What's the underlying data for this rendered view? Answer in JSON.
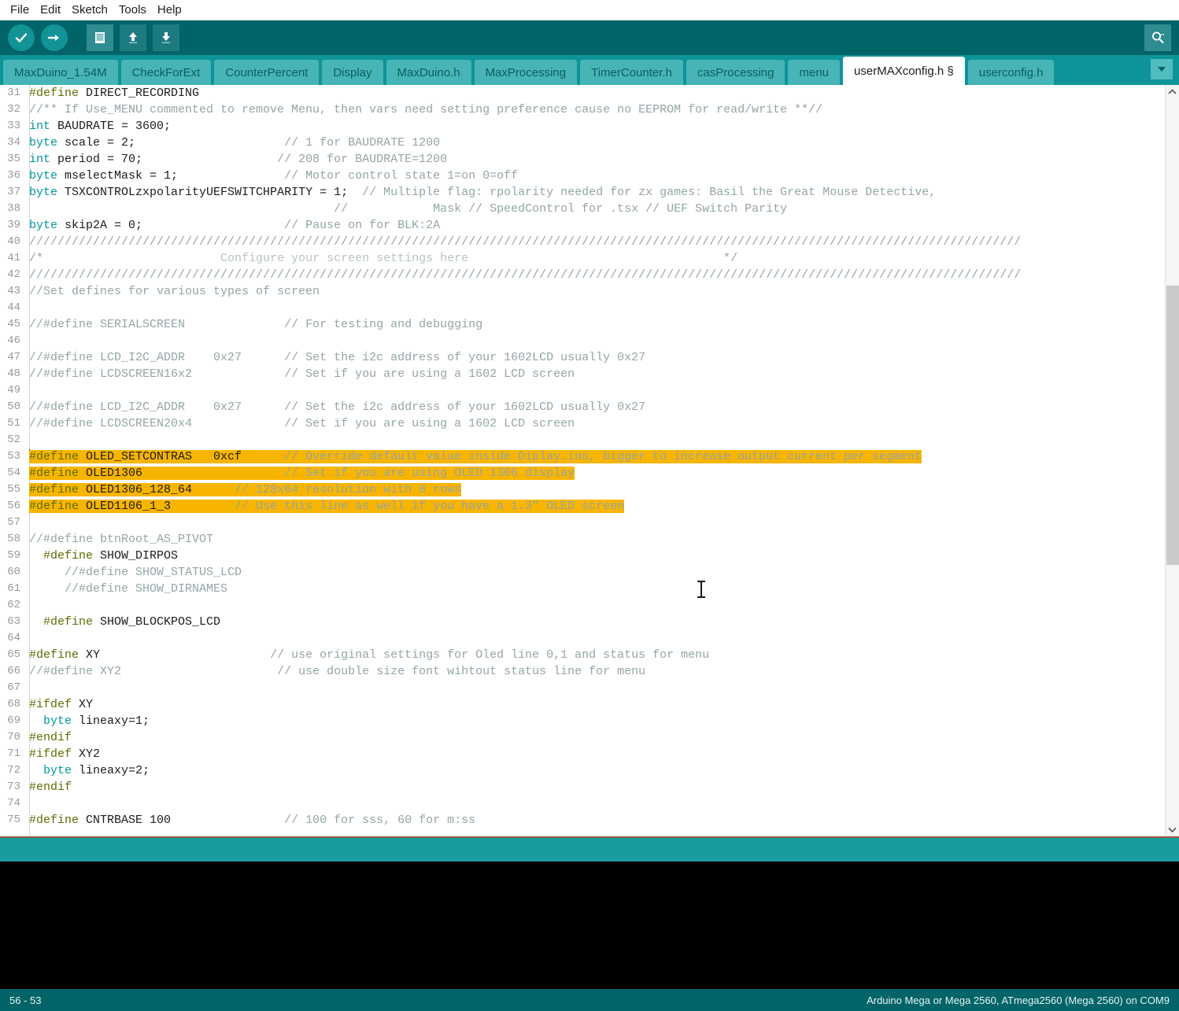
{
  "menubar": {
    "items": [
      {
        "label": "File"
      },
      {
        "label": "Edit"
      },
      {
        "label": "Sketch"
      },
      {
        "label": "Tools"
      },
      {
        "label": "Help"
      }
    ]
  },
  "toolbar": {
    "verify_label": "Verify",
    "upload_label": "Upload",
    "new_label": "New",
    "open_label": "Open",
    "save_label": "Save",
    "serial_monitor_label": "Serial Monitor",
    "colors": {
      "bar": "#006468",
      "round_button": "#129396",
      "square_button": "#2f8c90"
    }
  },
  "tabs": {
    "items": [
      {
        "label": "MaxDuino_1.54M",
        "active": false
      },
      {
        "label": "CheckForExt",
        "active": false
      },
      {
        "label": "CounterPercent",
        "active": false
      },
      {
        "label": "Display",
        "active": false
      },
      {
        "label": "MaxDuino.h",
        "active": false
      },
      {
        "label": "MaxProcessing",
        "active": false
      },
      {
        "label": "TimerCounter.h",
        "active": false
      },
      {
        "label": "casProcessing",
        "active": false
      },
      {
        "label": "menu",
        "active": false
      },
      {
        "label": "userMAXconfig.h §",
        "active": true
      },
      {
        "label": "userconfig.h",
        "active": false
      }
    ],
    "dropdown_label": "▼"
  },
  "editor": {
    "first_line_number": 31,
    "selection_color": "#f8b500",
    "lines": [
      {
        "n": 31,
        "parts": [
          {
            "t": "#define",
            "c": "pre"
          },
          {
            "t": " DIRECT_RECORDING",
            "c": "plain"
          }
        ]
      },
      {
        "n": 32,
        "parts": [
          {
            "t": "//** If Use_MENU commented to remove Menu, then vars need setting preference cause no EEPROM for read/write **//",
            "c": "com"
          }
        ]
      },
      {
        "n": 33,
        "parts": [
          {
            "t": "int",
            "c": "kw"
          },
          {
            "t": " BAUDRATE = 3600;",
            "c": "plain"
          }
        ]
      },
      {
        "n": 34,
        "parts": [
          {
            "t": "byte",
            "c": "kw"
          },
          {
            "t": " scale = 2;                     ",
            "c": "plain"
          },
          {
            "t": "// 1 for BAUDRATE 1200",
            "c": "com"
          }
        ]
      },
      {
        "n": 35,
        "parts": [
          {
            "t": "int",
            "c": "kw"
          },
          {
            "t": " period = 70;                   ",
            "c": "plain"
          },
          {
            "t": "// 208 for BAUDRATE=1200",
            "c": "com"
          }
        ]
      },
      {
        "n": 36,
        "parts": [
          {
            "t": "byte",
            "c": "kw"
          },
          {
            "t": " mselectMask = 1;               ",
            "c": "plain"
          },
          {
            "t": "// Motor control state 1=on 0=off",
            "c": "com"
          }
        ]
      },
      {
        "n": 37,
        "parts": [
          {
            "t": "byte",
            "c": "kw"
          },
          {
            "t": " TSXCONTROLzxpolarityUEFSWITCHPARITY = 1;  ",
            "c": "plain"
          },
          {
            "t": "// Multiple flag: rpolarity needed for zx games: Basil the Great Mouse Detective,",
            "c": "com"
          }
        ]
      },
      {
        "n": 38,
        "parts": [
          {
            "t": "                                           ",
            "c": "plain"
          },
          {
            "t": "//            Mask // SpeedControl for .tsx // UEF Switch Parity",
            "c": "com"
          }
        ]
      },
      {
        "n": 39,
        "parts": [
          {
            "t": "byte",
            "c": "kw"
          },
          {
            "t": " skip2A = 0;                    ",
            "c": "plain"
          },
          {
            "t": "// Pause on for BLK:2A",
            "c": "com"
          }
        ]
      },
      {
        "n": 40,
        "parts": [
          {
            "t": "////////////////////////////////////////////////////////////////////////////////////////////////////////////////////////////////////////////",
            "c": "com"
          }
        ]
      },
      {
        "n": 41,
        "parts": [
          {
            "t": "/*",
            "c": "com"
          },
          {
            "t": "                         Configure your screen settings here                                    ",
            "c": "light"
          },
          {
            "t": "*/",
            "c": "com"
          }
        ]
      },
      {
        "n": 42,
        "parts": [
          {
            "t": "////////////////////////////////////////////////////////////////////////////////////////////////////////////////////////////////////////////",
            "c": "com"
          }
        ]
      },
      {
        "n": 43,
        "parts": [
          {
            "t": "//Set defines for various types of screen",
            "c": "com"
          }
        ]
      },
      {
        "n": 44,
        "parts": []
      },
      {
        "n": 45,
        "parts": [
          {
            "t": "//#define SERIALSCREEN              ",
            "c": "com"
          },
          {
            "t": "// For testing and debugging",
            "c": "com"
          }
        ]
      },
      {
        "n": 46,
        "parts": []
      },
      {
        "n": 47,
        "parts": [
          {
            "t": "//#define LCD_I2C_ADDR    0x27      ",
            "c": "com"
          },
          {
            "t": "// Set the i2c address of your 1602LCD usually 0x27",
            "c": "com"
          }
        ]
      },
      {
        "n": 48,
        "parts": [
          {
            "t": "//#define LCDSCREEN16x2             ",
            "c": "com"
          },
          {
            "t": "// Set if you are using a 1602 LCD screen",
            "c": "com"
          }
        ]
      },
      {
        "n": 49,
        "parts": []
      },
      {
        "n": 50,
        "parts": [
          {
            "t": "//#define LCD_I2C_ADDR    0x27      ",
            "c": "com"
          },
          {
            "t": "// Set the i2c address of your 1602LCD usually 0x27",
            "c": "com"
          }
        ]
      },
      {
        "n": 51,
        "parts": [
          {
            "t": "//#define LCDSCREEN20x4             ",
            "c": "com"
          },
          {
            "t": "// Set if you are using a 1602 LCD screen",
            "c": "com"
          }
        ]
      },
      {
        "n": 52,
        "parts": []
      },
      {
        "n": 53,
        "selected": true,
        "caret": true,
        "parts": [
          {
            "t": "#define",
            "c": "pre"
          },
          {
            "t": " OLED_SETCONTRAS   0xcf      ",
            "c": "plain"
          },
          {
            "t": "// Override default value inside Diplay.ino, bigger to increase output current per segment",
            "c": "com"
          }
        ]
      },
      {
        "n": 54,
        "selected": true,
        "parts": [
          {
            "t": "#define",
            "c": "pre"
          },
          {
            "t": " OLED1306                    ",
            "c": "plain"
          },
          {
            "t": "// Set if you are using OLED 1306 display",
            "c": "com"
          }
        ]
      },
      {
        "n": 55,
        "selected": true,
        "parts": [
          {
            "t": "#define",
            "c": "pre"
          },
          {
            "t": " OLED1306_128_64      ",
            "c": "plain"
          },
          {
            "t": "// 128x64 resolution with 8 rows",
            "c": "com"
          }
        ]
      },
      {
        "n": 56,
        "selected": true,
        "parts": [
          {
            "t": "#define",
            "c": "pre"
          },
          {
            "t": " OLED1106_1_3         ",
            "c": "plain"
          },
          {
            "t": "// Use this line as well if you have a 1.3\" OLED screen",
            "c": "com"
          }
        ]
      },
      {
        "n": 57,
        "parts": []
      },
      {
        "n": 58,
        "parts": [
          {
            "t": "//#define btnRoot_AS_PIVOT",
            "c": "com"
          }
        ]
      },
      {
        "n": 59,
        "parts": [
          {
            "t": "  ",
            "c": "plain"
          },
          {
            "t": "#define",
            "c": "pre"
          },
          {
            "t": " SHOW_DIRPOS",
            "c": "plain"
          }
        ]
      },
      {
        "n": 60,
        "parts": [
          {
            "t": "     //#define SHOW_STATUS_LCD",
            "c": "com"
          }
        ]
      },
      {
        "n": 61,
        "parts": [
          {
            "t": "     //#define SHOW_DIRNAMES",
            "c": "com"
          }
        ]
      },
      {
        "n": 62,
        "parts": []
      },
      {
        "n": 63,
        "parts": [
          {
            "t": "  ",
            "c": "plain"
          },
          {
            "t": "#define",
            "c": "pre"
          },
          {
            "t": " SHOW_BLOCKPOS_LCD",
            "c": "plain"
          }
        ]
      },
      {
        "n": 64,
        "parts": []
      },
      {
        "n": 65,
        "parts": [
          {
            "t": "#define",
            "c": "pre"
          },
          {
            "t": " XY                        ",
            "c": "plain"
          },
          {
            "t": "// use original settings for Oled line 0,1 and status for menu",
            "c": "com"
          }
        ]
      },
      {
        "n": 66,
        "parts": [
          {
            "t": "//#define XY2                      ",
            "c": "com"
          },
          {
            "t": "// use double size font wihtout status line for menu",
            "c": "com"
          }
        ]
      },
      {
        "n": 67,
        "parts": []
      },
      {
        "n": 68,
        "parts": [
          {
            "t": "#ifdef",
            "c": "pre"
          },
          {
            "t": " XY",
            "c": "plain"
          }
        ]
      },
      {
        "n": 69,
        "parts": [
          {
            "t": "  ",
            "c": "plain"
          },
          {
            "t": "byte",
            "c": "kw"
          },
          {
            "t": " lineaxy=1;",
            "c": "plain"
          }
        ]
      },
      {
        "n": 70,
        "parts": [
          {
            "t": "#endif",
            "c": "pre"
          }
        ]
      },
      {
        "n": 71,
        "parts": [
          {
            "t": "#ifdef",
            "c": "pre"
          },
          {
            "t": " XY2",
            "c": "plain"
          }
        ]
      },
      {
        "n": 72,
        "parts": [
          {
            "t": "  ",
            "c": "plain"
          },
          {
            "t": "byte",
            "c": "kw"
          },
          {
            "t": " lineaxy=2;",
            "c": "plain"
          }
        ]
      },
      {
        "n": 73,
        "parts": [
          {
            "t": "#endif",
            "c": "pre"
          }
        ]
      },
      {
        "n": 74,
        "parts": []
      },
      {
        "n": 75,
        "parts": [
          {
            "t": "#define",
            "c": "pre"
          },
          {
            "t": " CNTRBASE 100                ",
            "c": "plain"
          },
          {
            "t": "// 100 for sss, 60 for m:ss",
            "c": "com"
          }
        ]
      }
    ]
  },
  "scrollbar": {
    "up_arrow": "^",
    "down_arrow": "v"
  },
  "statusbar": {
    "left": "56 - 53",
    "right": "Arduino Mega or Mega 2560, ATmega2560 (Mega 2560) on COM9"
  }
}
